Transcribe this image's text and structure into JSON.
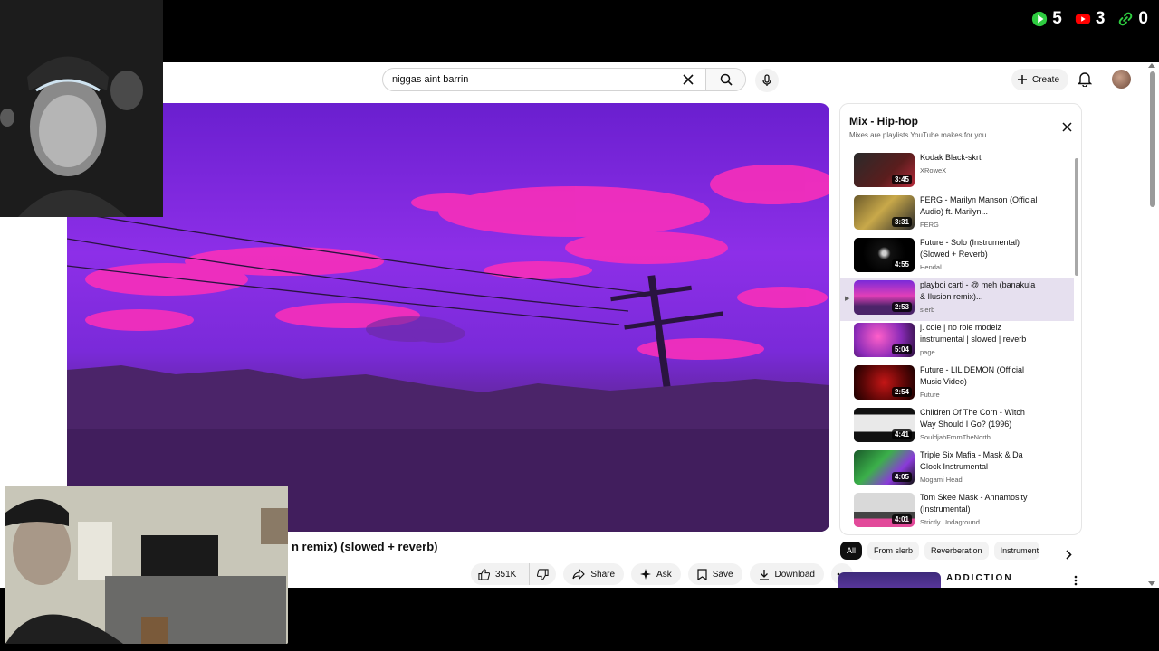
{
  "overlay": {
    "counters": [
      {
        "icon": "play-icon",
        "value": "5",
        "color": "#2ecc40"
      },
      {
        "icon": "youtube-icon",
        "value": "3",
        "color": "#ff0000"
      },
      {
        "icon": "link-icon",
        "value": "0",
        "color": "#2ecc40"
      }
    ]
  },
  "masthead": {
    "search_value": "niggas aint barrin",
    "create_label": "Create"
  },
  "video": {
    "title_visible": "n remix) (slowed + reverb)"
  },
  "actions": {
    "like_count": "351K",
    "share_label": "Share",
    "ask_label": "Ask",
    "save_label": "Save",
    "download_label": "Download"
  },
  "playlist": {
    "title": "Mix - Hip-hop",
    "subtitle": "Mixes are playlists YouTube makes for you",
    "items": [
      {
        "title": "Kodak Black-skrt",
        "channel": "XRoweX",
        "duration": "3:45"
      },
      {
        "title": "FERG - Marilyn Manson (Official Audio) ft. Marilyn...",
        "channel": "FERG",
        "duration": "3:31"
      },
      {
        "title": "Future - Solo (Instrumental) (Slowed + Reverb)",
        "channel": "Hendal",
        "duration": "4:55"
      },
      {
        "title": "playboi carti - @ meh (banakula & Ilusion remix)...",
        "channel": "slerb",
        "duration": "2:53"
      },
      {
        "title": "j. cole | no role modelz instrumental | slowed | reverb",
        "channel": "page",
        "duration": "5:04"
      },
      {
        "title": "Future - LIL DEMON (Official Music Video)",
        "channel": "Future",
        "duration": "2:54"
      },
      {
        "title": "Children Of The Corn - Witch Way Should I Go? (1996)",
        "channel": "SouldjahFromTheNorth",
        "duration": "4:41"
      },
      {
        "title": "Triple Six Mafia - Mask & Da Glock Instrumental",
        "channel": "Mogami Head",
        "duration": "4:05"
      },
      {
        "title": "Tom Skee Mask - Annamosity (Instrumental)",
        "channel": "Strictly Undaground",
        "duration": "4:01"
      }
    ]
  },
  "chips": [
    "All",
    "From slerb",
    "Reverberation",
    "Instrument"
  ],
  "recommendation": {
    "title": "ADDICTION"
  }
}
